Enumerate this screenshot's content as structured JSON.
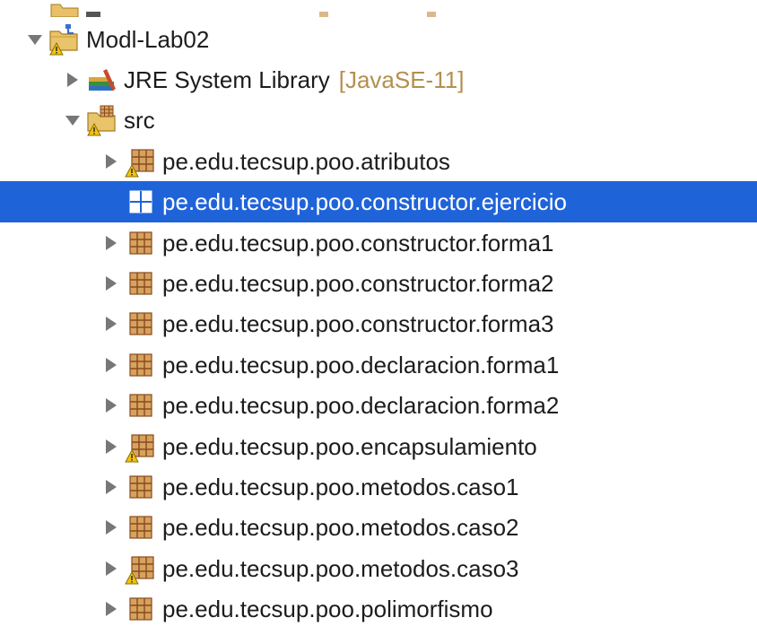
{
  "colors": {
    "selection": "#1f63d9",
    "decoration": "#b48f4e",
    "package_fill": "#d6a25f",
    "package_grid": "#8a4a1c",
    "warning": "#f2c40b"
  },
  "tree": {
    "project": {
      "label": "Modl-Lab02",
      "icon": "project-folder-warning-icon"
    },
    "library": {
      "label": "JRE System Library",
      "decoration": "[JavaSE-11]",
      "icon": "library-books-icon"
    },
    "src_folder": {
      "label": "src",
      "icon": "source-folder-warning-icon"
    },
    "packages": [
      {
        "label": "pe.edu.tecsup.poo.atributos",
        "warning": true,
        "expandable": true,
        "selected": false
      },
      {
        "label": "pe.edu.tecsup.poo.constructor.ejercicio",
        "warning": false,
        "expandable": false,
        "selected": true
      },
      {
        "label": "pe.edu.tecsup.poo.constructor.forma1",
        "warning": false,
        "expandable": true,
        "selected": false
      },
      {
        "label": "pe.edu.tecsup.poo.constructor.forma2",
        "warning": false,
        "expandable": true,
        "selected": false
      },
      {
        "label": "pe.edu.tecsup.poo.constructor.forma3",
        "warning": false,
        "expandable": true,
        "selected": false
      },
      {
        "label": "pe.edu.tecsup.poo.declaracion.forma1",
        "warning": false,
        "expandable": true,
        "selected": false
      },
      {
        "label": "pe.edu.tecsup.poo.declaracion.forma2",
        "warning": false,
        "expandable": true,
        "selected": false
      },
      {
        "label": "pe.edu.tecsup.poo.encapsulamiento",
        "warning": true,
        "expandable": true,
        "selected": false
      },
      {
        "label": "pe.edu.tecsup.poo.metodos.caso1",
        "warning": false,
        "expandable": true,
        "selected": false
      },
      {
        "label": "pe.edu.tecsup.poo.metodos.caso2",
        "warning": false,
        "expandable": true,
        "selected": false
      },
      {
        "label": "pe.edu.tecsup.poo.metodos.caso3",
        "warning": true,
        "expandable": true,
        "selected": false
      },
      {
        "label": "pe.edu.tecsup.poo.polimorfismo",
        "warning": false,
        "expandable": true,
        "selected": false
      }
    ]
  }
}
